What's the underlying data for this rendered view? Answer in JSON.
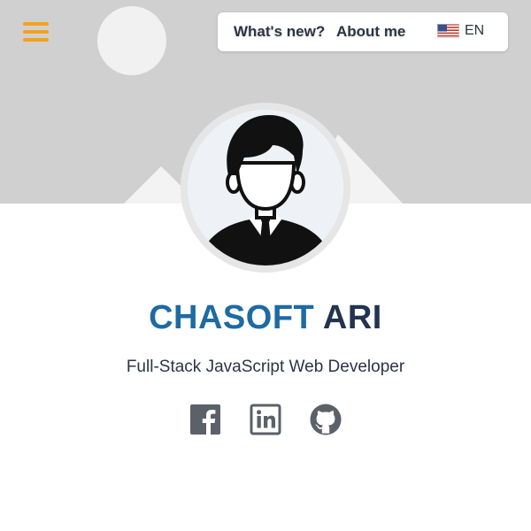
{
  "header": {
    "menu_icon": "hamburger-menu-icon",
    "nav": [
      {
        "label": "What's new?"
      },
      {
        "label": "About me"
      }
    ],
    "language": {
      "code": "EN",
      "flag_icon": "us-flag-icon"
    }
  },
  "profile": {
    "first_name": "CHASOFT",
    "last_name": "ARI",
    "title": "Full-Stack JavaScript Web Developer"
  },
  "social": [
    {
      "icon": "facebook-icon"
    },
    {
      "icon": "linkedin-icon"
    },
    {
      "icon": "github-icon"
    }
  ],
  "colors": {
    "accent": "#f5a11c",
    "name_first": "#1e6aa3",
    "name_last": "#22344f",
    "hero_bg": "#d0d0d0",
    "icon_gray": "#5b6169"
  }
}
